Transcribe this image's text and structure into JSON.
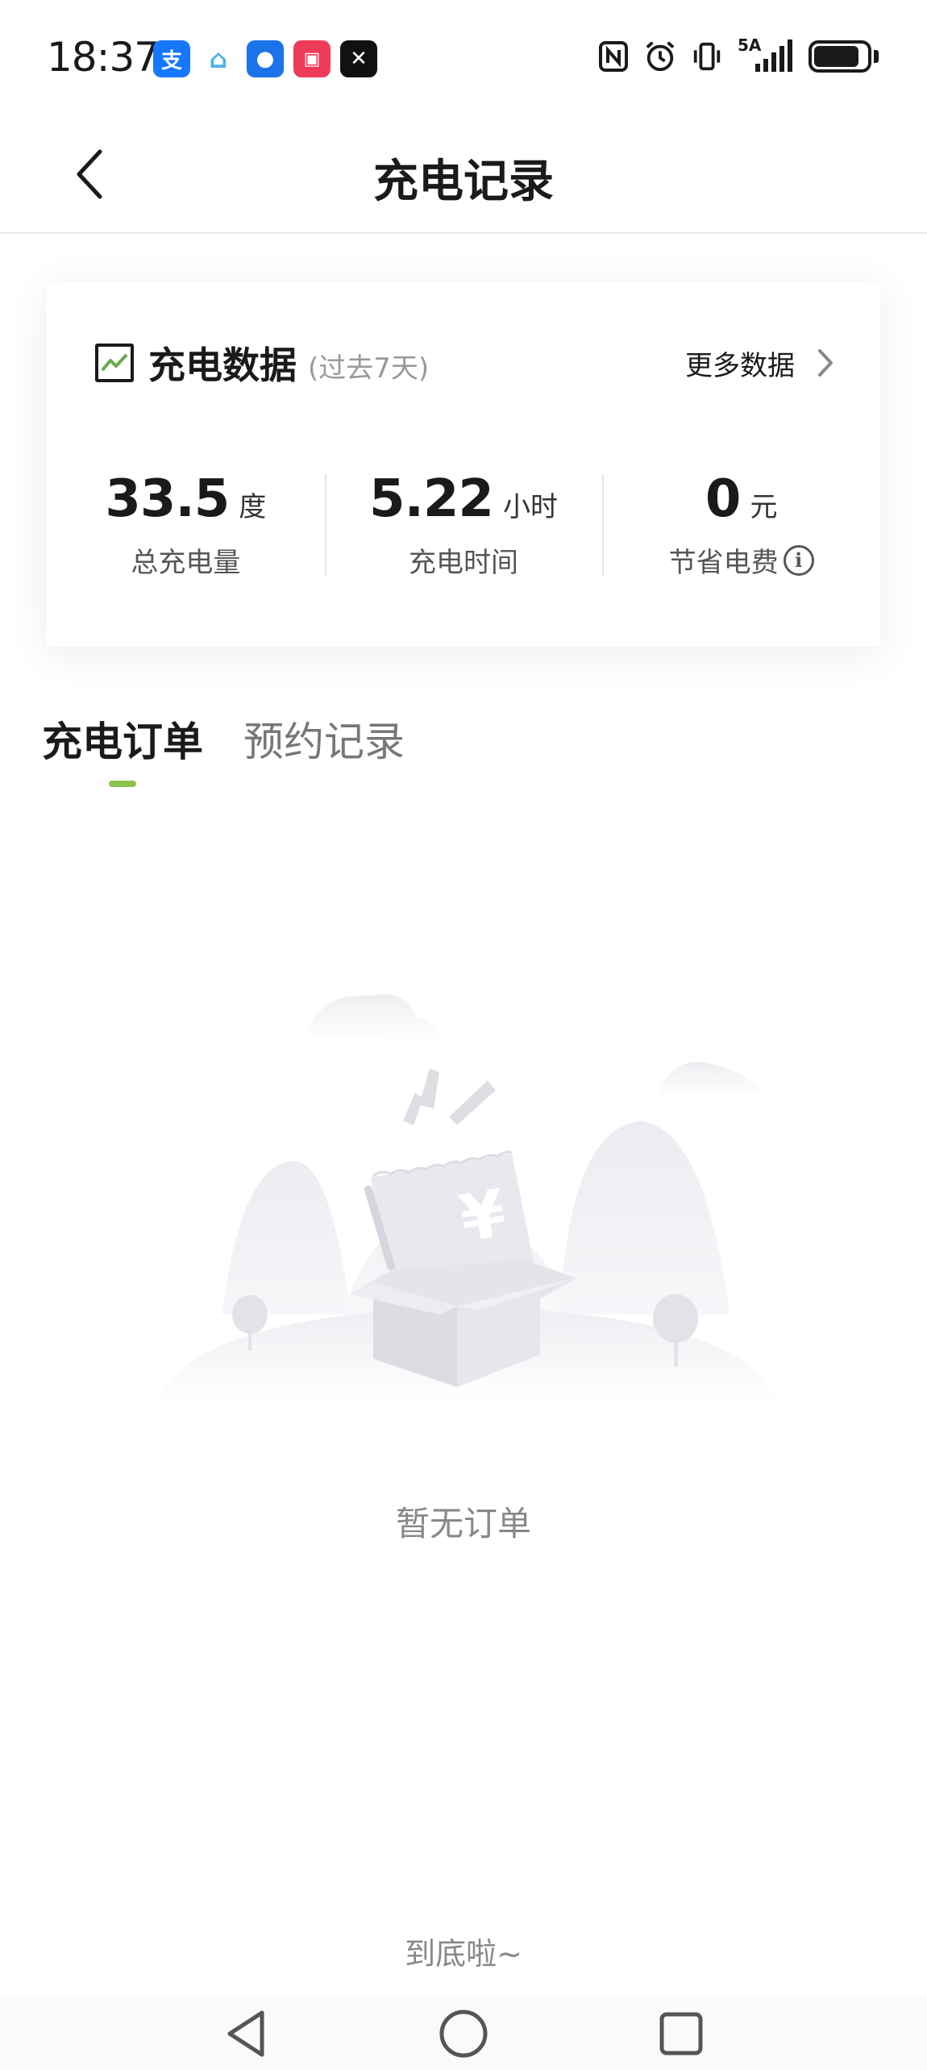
{
  "status_bar": {
    "time": "18:37",
    "network": "5A",
    "battery": "79",
    "apps": [
      {
        "icon": "alipay-icon",
        "glyph": "支",
        "color": "#1677ff"
      },
      {
        "icon": "smart-home-icon",
        "glyph": "⌂",
        "color": "#4fb3e6"
      },
      {
        "icon": "chat-app-icon",
        "glyph": "●",
        "color": "#1a73e8"
      },
      {
        "icon": "app-gallery-icon",
        "glyph": "▣",
        "color": "#ef3b5a"
      },
      {
        "icon": "capcut-icon",
        "glyph": "✕",
        "color": "#111111"
      }
    ]
  },
  "header": {
    "title": "充电记录"
  },
  "stats_card": {
    "title": "充电数据",
    "subtitle": "(过去7天)",
    "more_label": "更多数据",
    "stats": [
      {
        "value": "33.5",
        "unit": "度",
        "label": "总充电量"
      },
      {
        "value": "5.22",
        "unit": "小时",
        "label": "充电时间"
      },
      {
        "value": "0",
        "unit": "元",
        "label": "节省电费"
      }
    ]
  },
  "tabs": [
    {
      "label": "充电订单",
      "active": true
    },
    {
      "label": "预约记录",
      "active": false
    }
  ],
  "empty_state": {
    "message": "暂无订单",
    "symbol": "¥"
  },
  "footer": {
    "end_text": "到底啦~"
  },
  "colors": {
    "accent": "#8bc34a",
    "text_primary": "#1a1a1a",
    "text_secondary": "#888888"
  }
}
